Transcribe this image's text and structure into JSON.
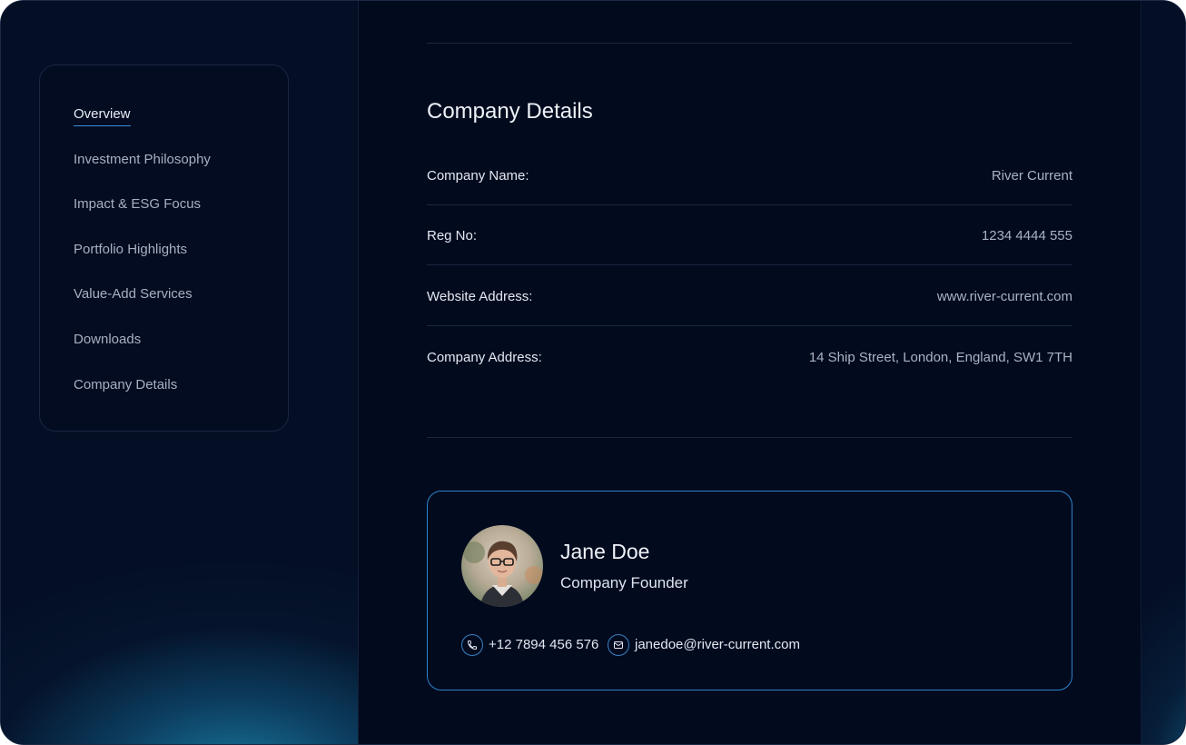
{
  "sidebar": {
    "items": [
      {
        "label": "Overview",
        "active": true
      },
      {
        "label": "Investment Philosophy",
        "active": false
      },
      {
        "label": "Impact & ESG Focus",
        "active": false
      },
      {
        "label": "Portfolio Highlights",
        "active": false
      },
      {
        "label": "Value-Add Services",
        "active": false
      },
      {
        "label": "Downloads",
        "active": false
      },
      {
        "label": "Company Details",
        "active": false
      }
    ]
  },
  "company_details": {
    "title": "Company Details",
    "rows": [
      {
        "label": "Company Name:",
        "value": "River Current"
      },
      {
        "label": "Reg No:",
        "value": "1234 4444 555"
      },
      {
        "label": "Website Address:",
        "value": "www.river-current.com"
      },
      {
        "label": "Company Address:",
        "value": "14 Ship Street, London, England, SW1 7TH"
      }
    ]
  },
  "contact": {
    "name": "Jane Doe",
    "role": "Company Founder",
    "phone": "+12  7894 456 576",
    "email": "janedoe@river-current.com",
    "phone_icon": "phone-icon",
    "email_icon": "mail-icon"
  },
  "colors": {
    "background": "#020a1e",
    "accent": "#2d83c9",
    "active_underline": "#3f8fd8"
  }
}
